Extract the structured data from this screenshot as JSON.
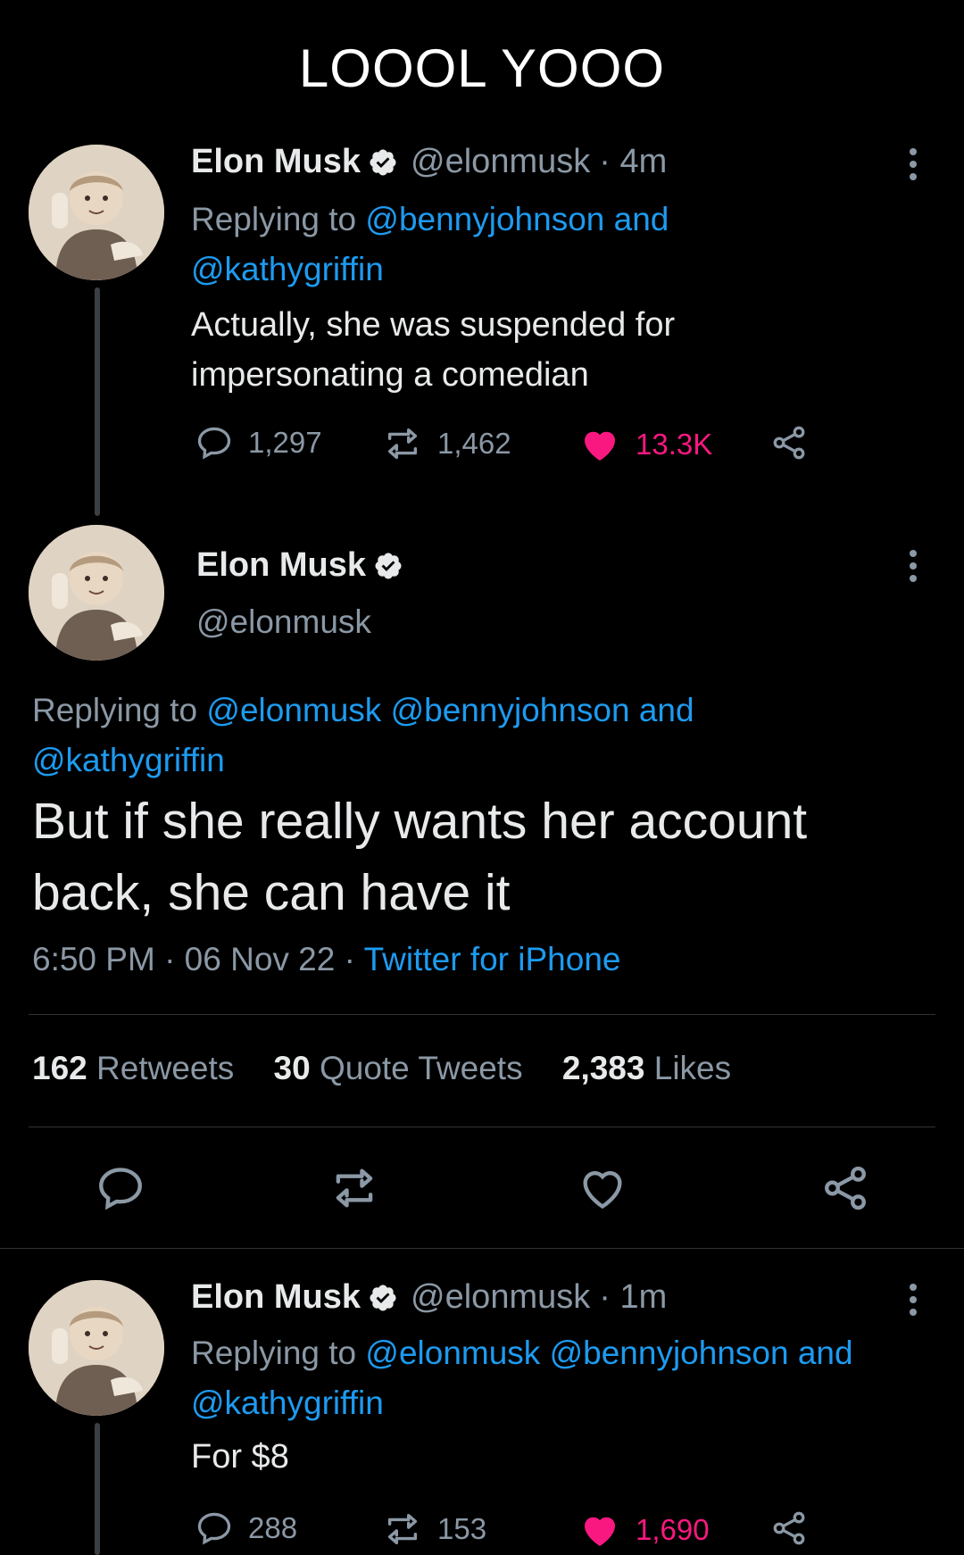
{
  "caption": "LOOOL YOOO",
  "tweet1": {
    "name": "Elon Musk",
    "handle": "@elonmusk",
    "time": "· 4m",
    "replying_prefix": "Replying to",
    "replying_users": "@bennyjohnson and",
    "replying_users2": "@kathygriffin",
    "text_line1": "Actually, she was suspended for",
    "text_line2": "impersonating a comedian",
    "replies": "1,297",
    "retweets": "1,462",
    "likes": "13.3K"
  },
  "tweet2": {
    "name": "Elon Musk",
    "handle": "@elonmusk",
    "replying_prefix": "Replying to",
    "replying_users": "@elonmusk @bennyjohnson and",
    "replying_users2": "@kathygriffin",
    "text_line1": "But if she really wants her account",
    "text_line2": "back, she can have it",
    "timestamp": "6:50 PM · 06 Nov 22 ·",
    "source": "Twitter for iPhone",
    "retweets_count": "162",
    "retweets_label": "Retweets",
    "quotes_count": "30",
    "quotes_label": "Quote Tweets",
    "likes_count": "2,383",
    "likes_label": "Likes"
  },
  "tweet3": {
    "name": "Elon Musk",
    "handle": "@elonmusk",
    "time": "· 1m",
    "replying_prefix": "Replying to",
    "replying_users": "@elonmusk @bennyjohnson and",
    "replying_users2": "@kathygriffin",
    "text": "For $8",
    "replies": "288",
    "retweets": "153",
    "likes": "1,690"
  },
  "colors": {
    "background": "#000000",
    "link": "#1d9bf0",
    "like": "#f91880",
    "muted": "#8b98a5"
  }
}
